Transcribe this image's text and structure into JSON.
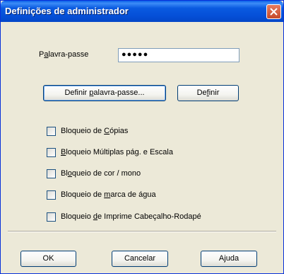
{
  "window": {
    "title": "Definições de administrador",
    "close_icon": "close-icon"
  },
  "password": {
    "label_pre": "P",
    "label_ul": "a",
    "label_post": "lavra-passe",
    "value": "●●●●●"
  },
  "buttons": {
    "set_password": {
      "pre": "Definir ",
      "ul": "p",
      "post": "alavra-passe..."
    },
    "define": {
      "pre": "De",
      "ul": "f",
      "post": "inir"
    },
    "ok": "OK",
    "cancel": "Cancelar",
    "help": "Ajuda"
  },
  "options": [
    {
      "pre": "Bloqueio de ",
      "ul": "C",
      "post": "ópias",
      "checked": false
    },
    {
      "pre": "",
      "ul": "B",
      "post": "loqueio Múltiplas pág. e Escala",
      "checked": false
    },
    {
      "pre": "Bl",
      "ul": "o",
      "post": "queio de cor / mono",
      "checked": false
    },
    {
      "pre": "Bloqueio de ",
      "ul": "m",
      "post": "arca de água",
      "checked": false
    },
    {
      "pre": "Bloqueio ",
      "ul": "d",
      "post": "e Imprime Cabeçalho-Rodapé",
      "checked": false
    }
  ]
}
